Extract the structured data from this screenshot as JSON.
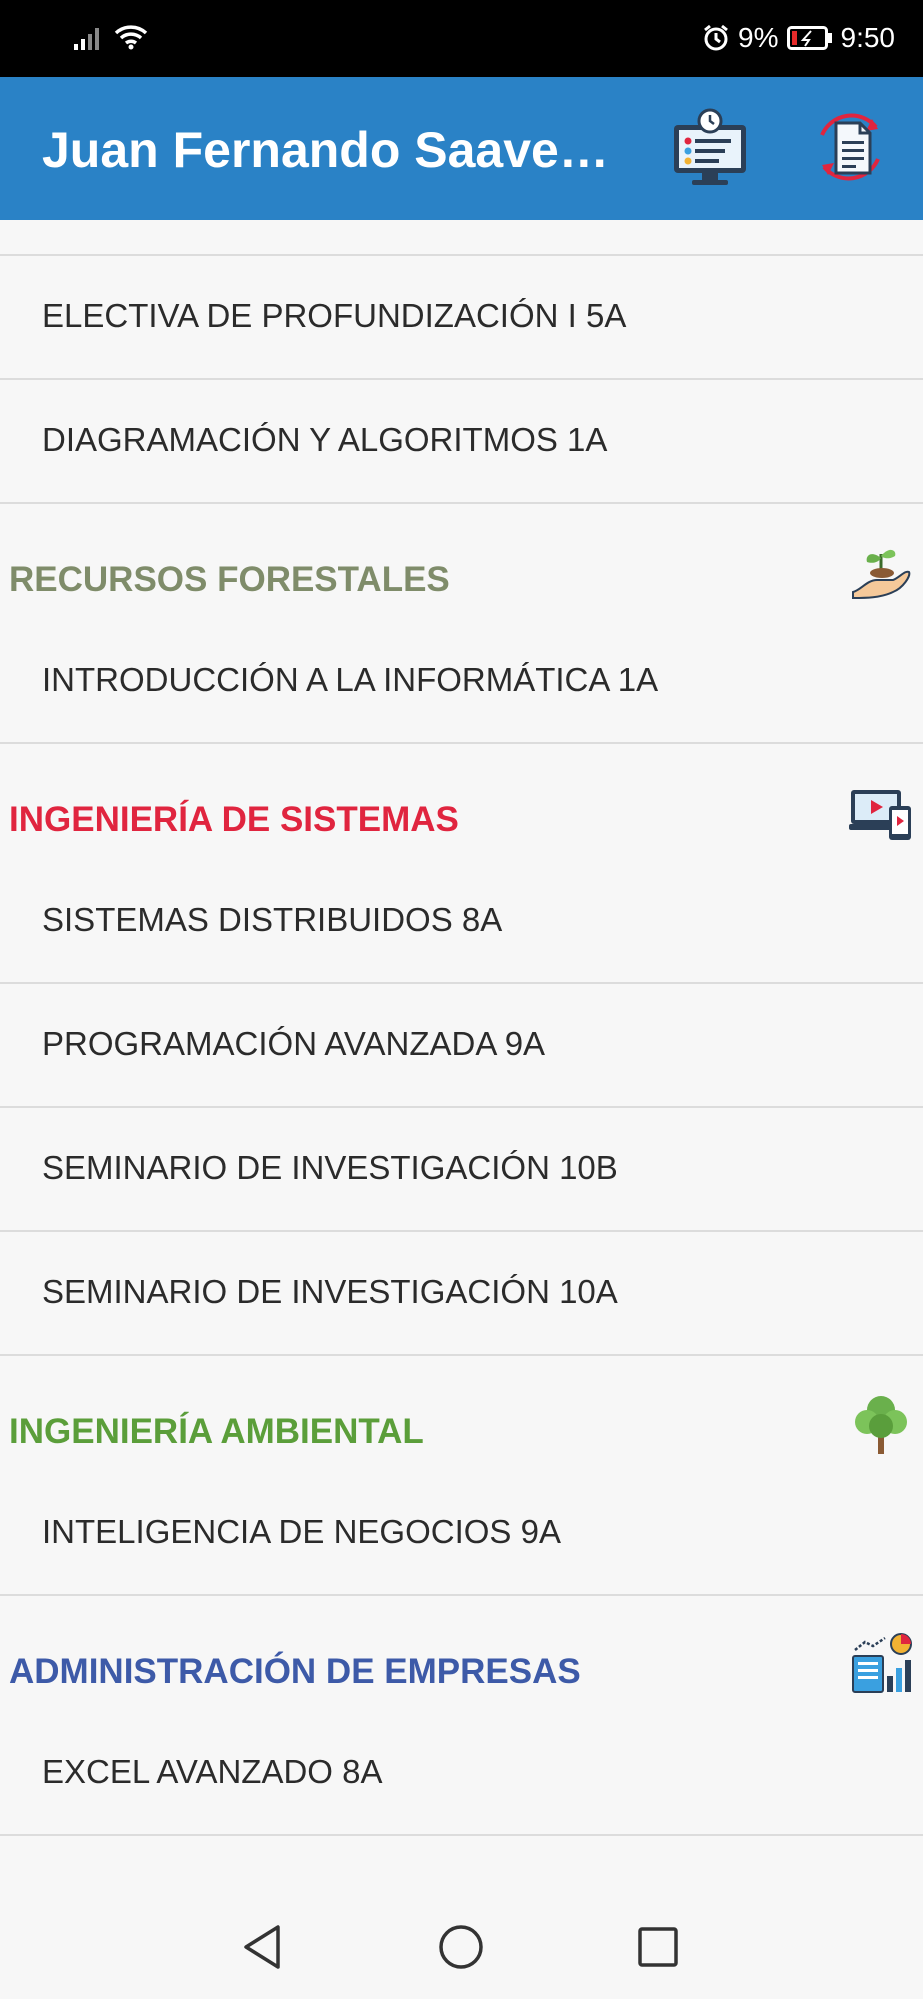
{
  "status_bar": {
    "battery": "9%",
    "time": "9:50"
  },
  "app_bar": {
    "title": "Juan Fernando Saavedr...",
    "actions": [
      "schedule-monitor-icon",
      "document-sync-icon"
    ]
  },
  "list": {
    "top_items": [
      {
        "label": "ELECTIVA DE PROFUNDIZACIÓN I 5A"
      },
      {
        "label": "DIAGRAMACIÓN Y ALGORITMOS 1A"
      }
    ],
    "sections": [
      {
        "title": "RECURSOS FORESTALES",
        "color": "#7f8c6a",
        "icon": "plant-hand-icon",
        "items": [
          {
            "label": "INTRODUCCIÓN A LA INFORMÁTICA 1A"
          }
        ]
      },
      {
        "title": "INGENIERÍA DE SISTEMAS",
        "color": "#e0253f",
        "icon": "devices-icon",
        "items": [
          {
            "label": "SISTEMAS DISTRIBUIDOS 8A"
          },
          {
            "label": "PROGRAMACIÓN AVANZADA 9A"
          },
          {
            "label": "SEMINARIO DE INVESTIGACIÓN 10B"
          },
          {
            "label": "SEMINARIO DE INVESTIGACIÓN 10A"
          }
        ]
      },
      {
        "title": "INGENIERÍA AMBIENTAL",
        "color": "#5b9e3a",
        "icon": "tree-icon",
        "items": [
          {
            "label": "INTELIGENCIA DE NEGOCIOS 9A"
          }
        ]
      },
      {
        "title": "ADMINISTRACIÓN DE EMPRESAS",
        "color": "#3d5aa8",
        "icon": "business-chart-icon",
        "items": [
          {
            "label": "EXCEL AVANZADO 8A"
          }
        ]
      }
    ]
  },
  "navigation_bar": {
    "buttons": [
      "back-icon",
      "home-icon",
      "recents-icon"
    ]
  }
}
